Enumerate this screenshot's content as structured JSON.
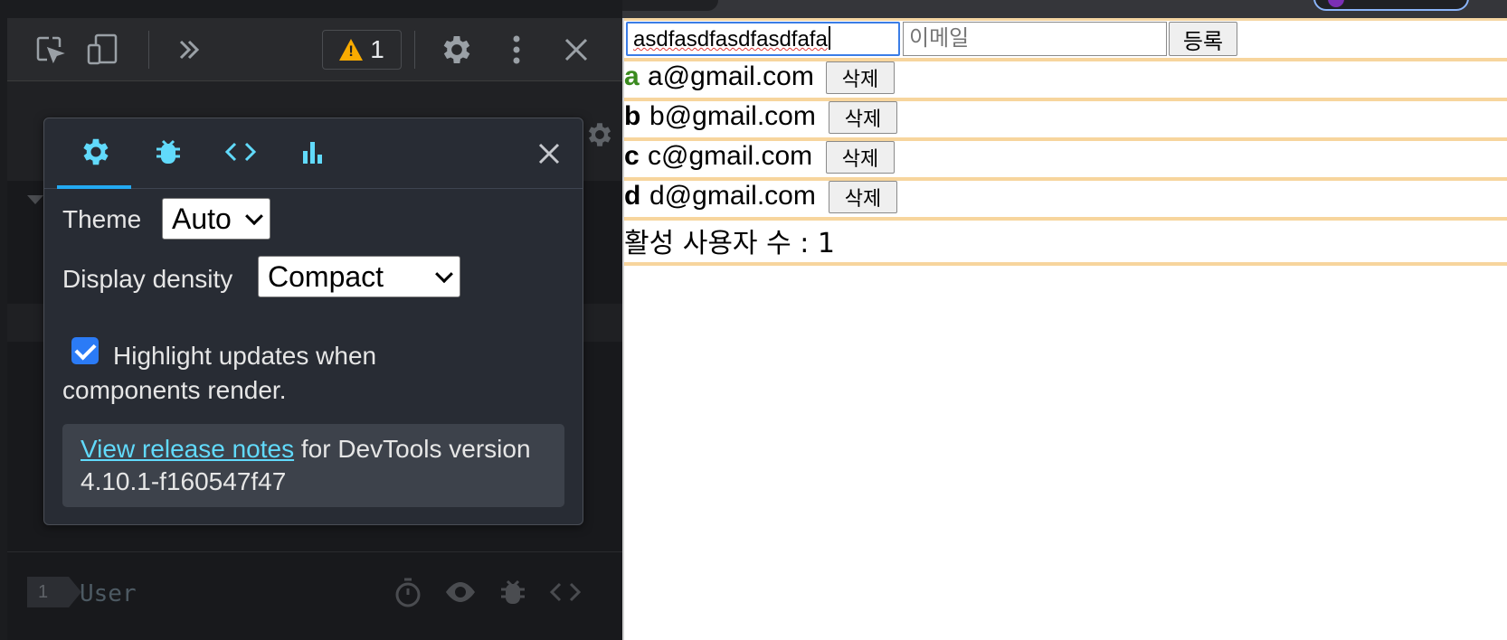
{
  "devtools": {
    "warning_count": "1",
    "settings": {
      "tabs": [
        {
          "icon": "gear-icon",
          "active": true
        },
        {
          "icon": "bug-icon",
          "active": false
        },
        {
          "icon": "code-icon",
          "active": false
        },
        {
          "icon": "profiler-icon",
          "active": false
        }
      ],
      "theme_label": "Theme",
      "theme_value": "Auto",
      "density_label": "Display density",
      "density_value": "Compact",
      "highlight_label": "Highlight updates when components render.",
      "highlight_checked": true,
      "release_link": "View release notes",
      "release_text": " for DevTools version 4.10.1-f160547f47"
    },
    "tree": {
      "rank": "1",
      "component_name": "User"
    }
  },
  "app": {
    "name_input_value": "asdfasdfasdfasdfafa",
    "email_placeholder": "이메일",
    "register_label": "등록",
    "users": [
      {
        "name": "a",
        "email": "a@gmail.com",
        "active": true,
        "delete_label": "삭제"
      },
      {
        "name": "b",
        "email": "b@gmail.com",
        "active": false,
        "delete_label": "삭제"
      },
      {
        "name": "c",
        "email": "c@gmail.com",
        "active": false,
        "delete_label": "삭제"
      },
      {
        "name": "d",
        "email": "d@gmail.com",
        "active": false,
        "delete_label": "삭제"
      }
    ],
    "active_count_text": "활성 사용자 수 : 1"
  },
  "colors": {
    "react_blue": "#61dafb",
    "active_user_green": "#3a8a1f",
    "highlight_border": "#f7d59d",
    "checkbox_blue": "#2b7bf6"
  }
}
